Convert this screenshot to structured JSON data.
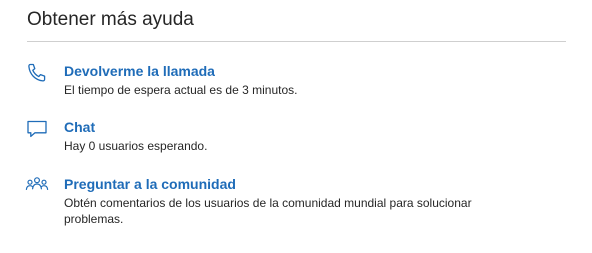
{
  "header": {
    "title": "Obtener más ayuda"
  },
  "options": [
    {
      "icon": "phone-icon",
      "label": "Devolverme la llamada",
      "description": "El tiempo de espera actual es de 3 minutos."
    },
    {
      "icon": "chat-bubble-icon",
      "label": "Chat",
      "description": "Hay 0 usuarios esperando."
    },
    {
      "icon": "community-icon",
      "label": "Preguntar a la comunidad",
      "description": "Obtén comentarios de los usuarios de la comunidad mundial para solucionar problemas."
    }
  ],
  "colors": {
    "link": "#1f6cb8",
    "text": "#262626",
    "icon": "#1f6cb8",
    "divider": "#cfcfcf"
  }
}
